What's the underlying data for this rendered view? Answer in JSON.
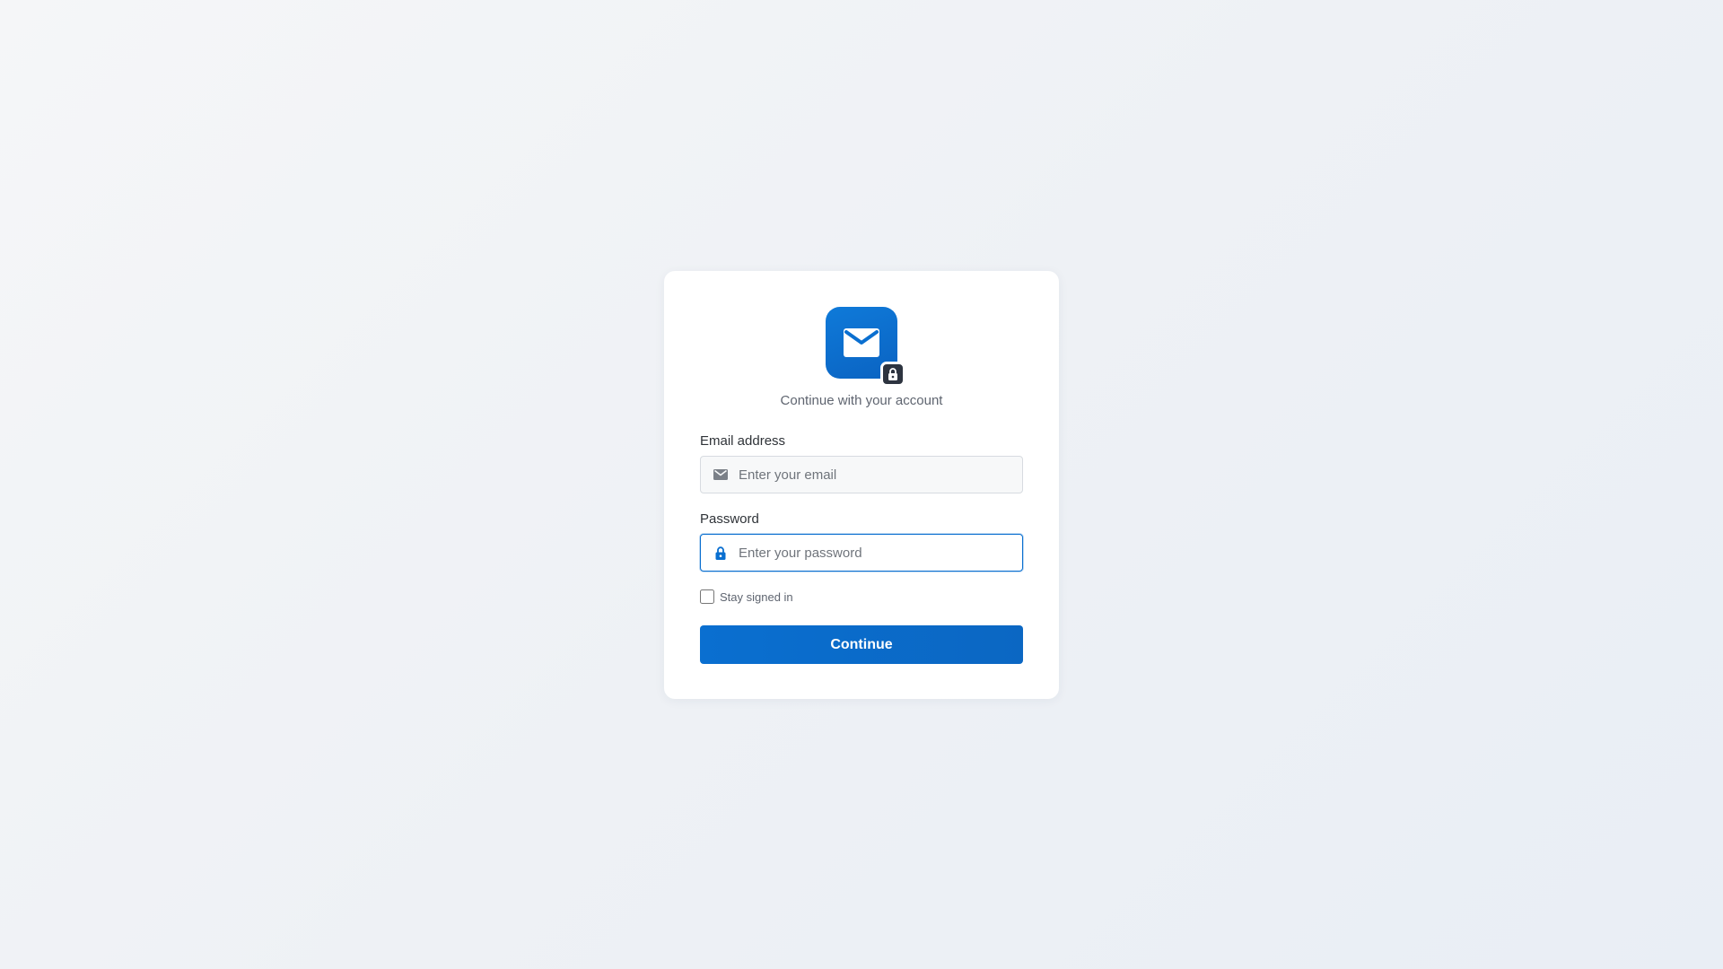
{
  "logo": {
    "icon": "mail-icon",
    "badge_icon": "lock-icon"
  },
  "subtitle": "Continue with your account",
  "email": {
    "label": "Email address",
    "placeholder": "Enter your email",
    "value": "",
    "icon": "mail-icon"
  },
  "password": {
    "label": "Password",
    "placeholder": "Enter your password",
    "value": "",
    "icon": "lock-icon"
  },
  "remember": {
    "label": "Stay signed in",
    "checked": false
  },
  "continue_label": "Continue",
  "colors": {
    "accent": "#0a6fd0",
    "badge": "#2d3440",
    "background": "#eef1f5",
    "card": "#ffffff"
  }
}
